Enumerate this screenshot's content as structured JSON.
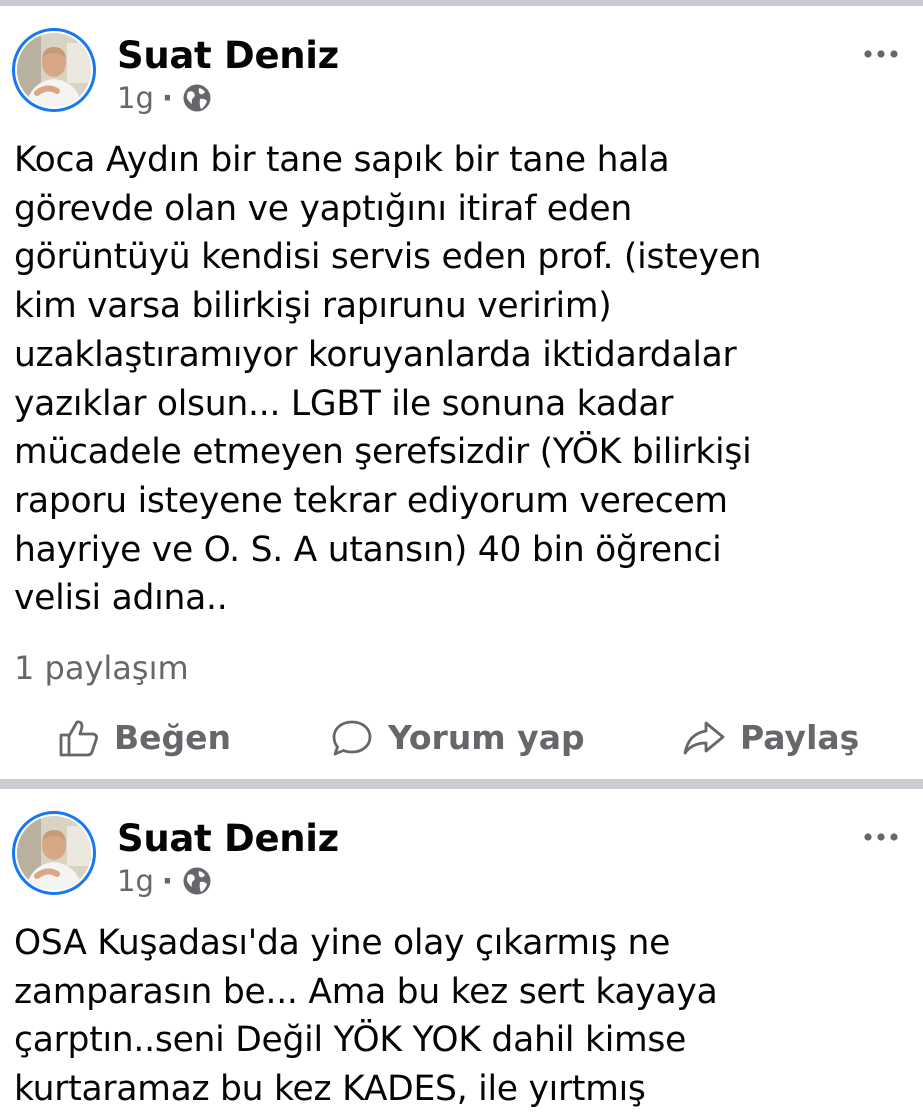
{
  "feed": {
    "posts": [
      {
        "author": "Suat Deniz",
        "time": "1g",
        "separator": "·",
        "privacy_icon": "globe-icon",
        "more_icon": "more-options-icon",
        "body_lines": [
          "Koca Aydın  bir tane sapık bir tane hala",
          "görevde olan ve yaptığını itiraf eden",
          "görüntüyü kendisi servis eden prof. (isteyen",
          "kim varsa bilirkişi rapırunu veririm)",
          "uzaklaştıramıyor koruyanlarda iktidardalar",
          "yazıklar olsun... LGBT ile sonuna  kadar",
          "mücadele etmeyen şerefsizdir (YÖK bilirkişi",
          "raporu isteyene tekrar ediyorum verecem",
          "hayriye ve O. S. A utansın)  40 bin öğrenci",
          "velisi adına.."
        ],
        "shares": "1 paylaşım",
        "actions": {
          "like": "Beğen",
          "comment": "Yorum yap",
          "share": "Paylaş"
        }
      },
      {
        "author": "Suat Deniz",
        "time": "1g",
        "separator": "·",
        "privacy_icon": "globe-icon",
        "more_icon": "more-options-icon",
        "body_lines": [
          "OSA Kuşadası'da yine olay çıkarmış ne",
          "zamparasın be... Ama bu kez sert kayaya",
          "çarptın..seni Değil YÖK YOK dahil kimse",
          "kurtaramaz bu kez KADES, ile yırtmış"
        ]
      }
    ]
  },
  "colors": {
    "accent": "#1877f2",
    "secondary_text": "#65676b",
    "primary_text": "#050505",
    "separator": "#c9ccd1"
  }
}
